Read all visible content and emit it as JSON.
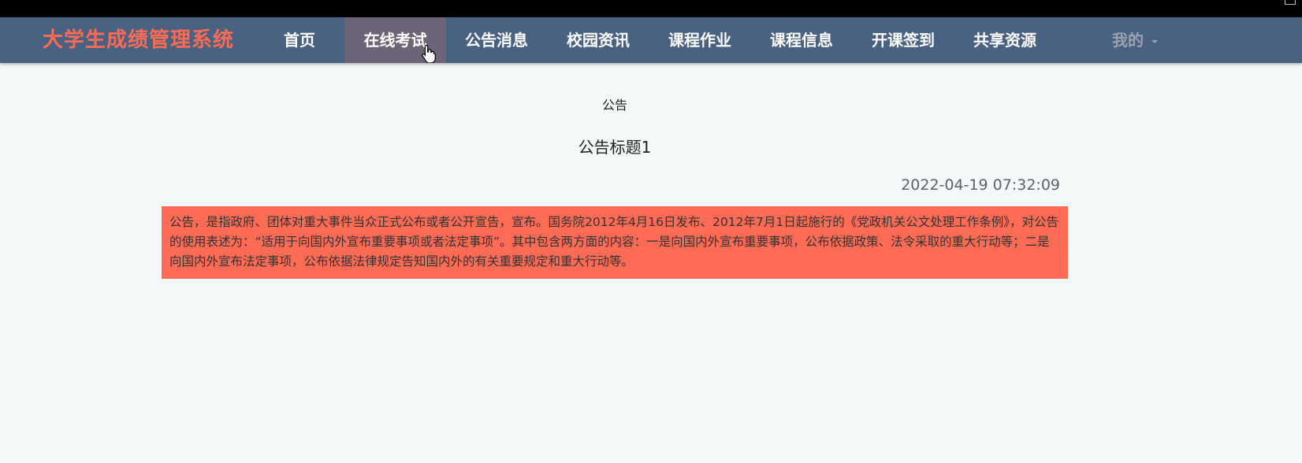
{
  "app": {
    "title": "大学生成绩管理系统"
  },
  "nav": {
    "items": [
      {
        "label": "首页"
      },
      {
        "label": "在线考试"
      },
      {
        "label": "公告消息"
      },
      {
        "label": "校园资讯"
      },
      {
        "label": "课程作业"
      },
      {
        "label": "课程信息"
      },
      {
        "label": "开课签到"
      },
      {
        "label": "共享资源"
      }
    ],
    "active_index": 1,
    "user_label": "我的"
  },
  "content": {
    "section_title": "公告",
    "notice_title": "公告标题1",
    "notice_time": "2022-04-19 07:32:09",
    "notice_body": "公告，是指政府、团体对重大事件当众正式公布或者公开宣告，宣布。国务院2012年4月16日发布、2012年7月1日起施行的《党政机关公文处理工作条例》，对公告的使用表述为：“适用于向国内外宣布重要事项或者法定事项”。其中包含两方面的内容：一是向国内外宣布重要事项，公布依据政策、法令采取的重大行动等；二是向国内外宣布法定事项，公布依据法律规定告知国内外的有关重要规定和重大行动等。"
  },
  "colors": {
    "navbar_bg": "#4a6281",
    "brand": "#ff6b55",
    "active_item_bg": "#6d6478",
    "notice_bg": "#ff6b55",
    "page_bg": "#f3f8f8"
  },
  "icons": {
    "cursor": "hand-pointer-icon",
    "user_menu": "caret-down-icon"
  }
}
